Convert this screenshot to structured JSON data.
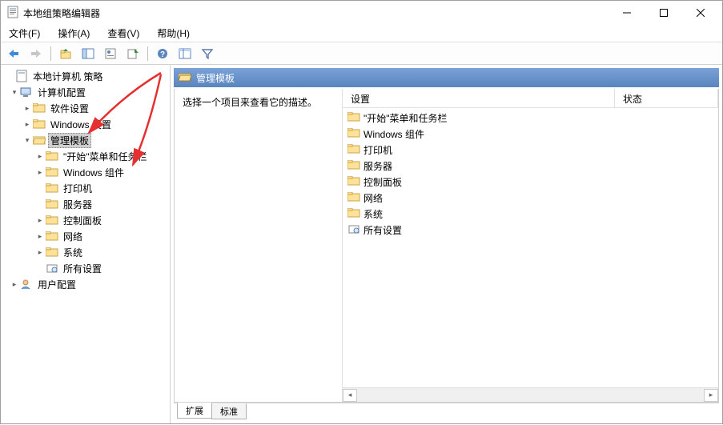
{
  "window": {
    "title": "本地组策略编辑器"
  },
  "menu": {
    "file": "文件(F)",
    "action": "操作(A)",
    "view": "查看(V)",
    "help": "帮助(H)"
  },
  "tree": {
    "root": "本地计算机 策略",
    "computer_config": "计算机配置",
    "software": "软件设置",
    "windows_settings": "Windows 设置",
    "admin_templates": "管理模板",
    "start_taskbar": "\"开始\"菜单和任务栏",
    "windows_components": "Windows 组件",
    "printers": "打印机",
    "servers": "服务器",
    "control_panel": "控制面板",
    "network": "网络",
    "system": "系统",
    "all_settings": "所有设置",
    "user_config": "用户配置"
  },
  "content": {
    "header": "管理模板",
    "description_prompt": "选择一个项目来查看它的描述。",
    "col_setting": "设置",
    "col_status": "状态",
    "items": {
      "start_taskbar": "\"开始\"菜单和任务栏",
      "windows_components": "Windows 组件",
      "printers": "打印机",
      "servers": "服务器",
      "control_panel": "控制面板",
      "network": "网络",
      "system": "系统",
      "all_settings": "所有设置"
    }
  },
  "tabs": {
    "extended": "扩展",
    "standard": "标准"
  }
}
